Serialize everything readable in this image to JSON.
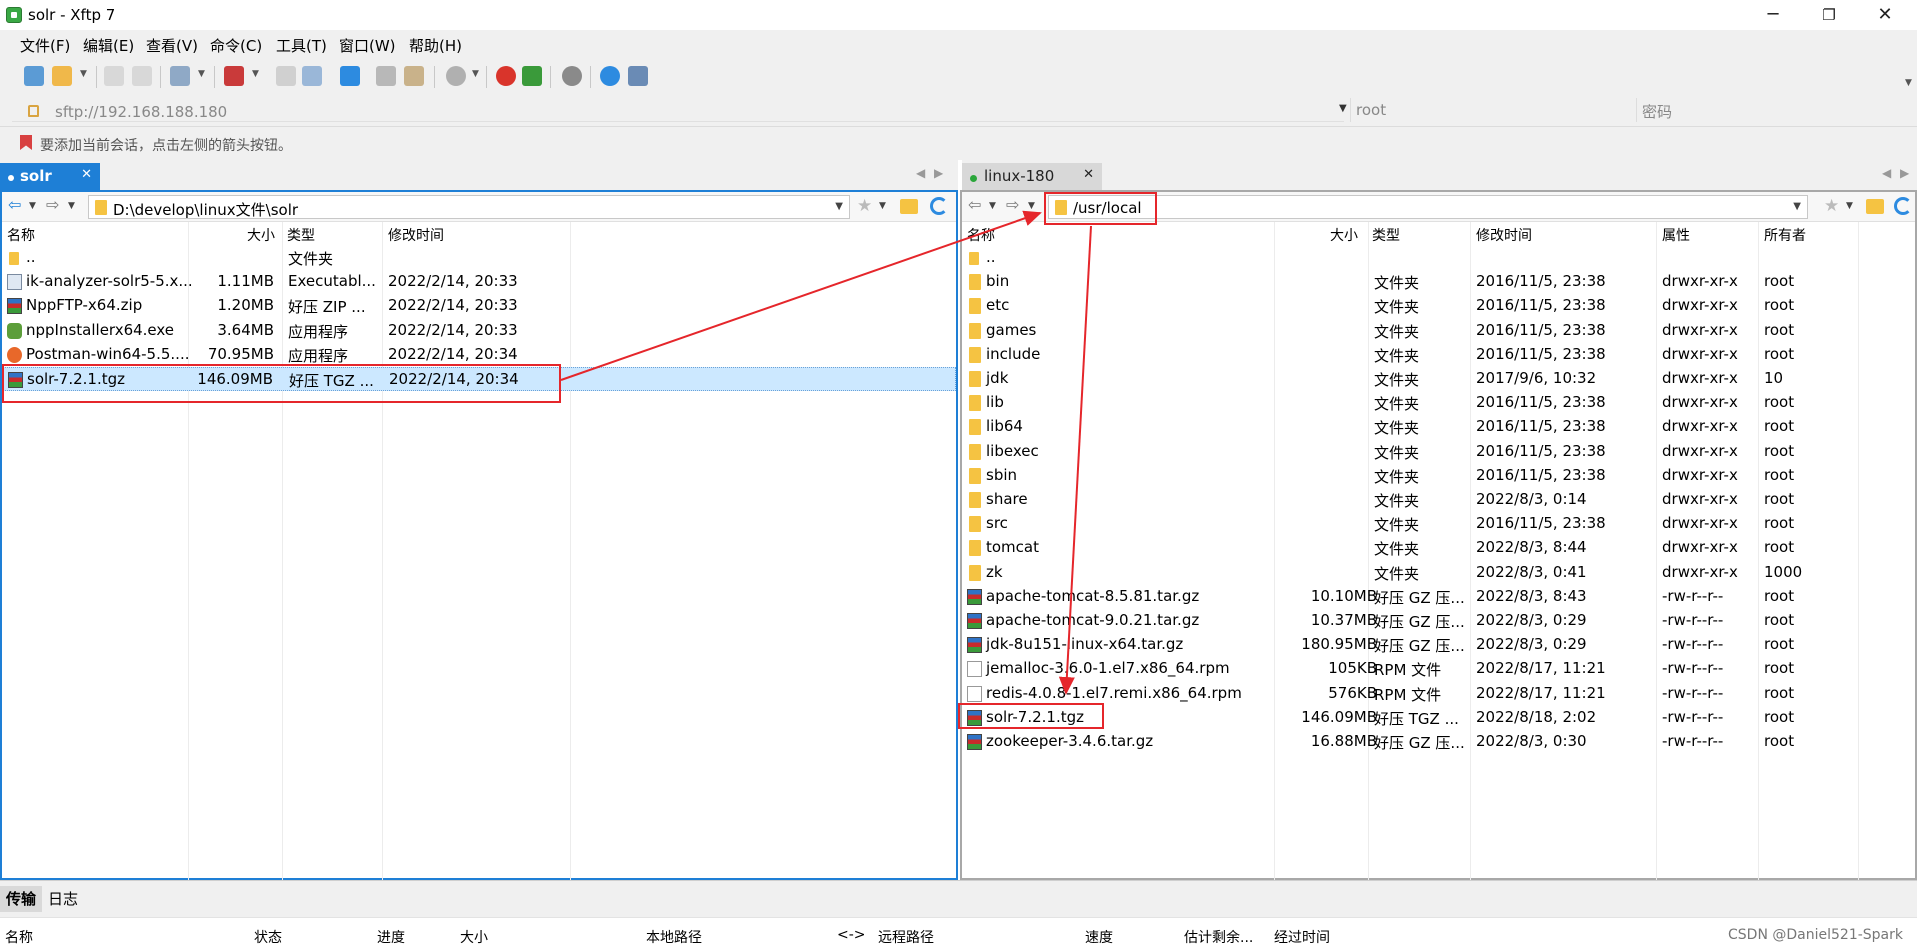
{
  "window": {
    "title": "solr - Xftp 7"
  },
  "menu": [
    "文件(F)",
    "编辑(E)",
    "查看(V)",
    "命令(C)",
    "工具(T)",
    "窗口(W)",
    "帮助(H)"
  ],
  "address": {
    "url": "sftp://192.168.188.180",
    "user_placeholder": "root",
    "password_placeholder": "密码"
  },
  "hint": "要添加当前会话，点击左侧的箭头按钮。",
  "local": {
    "tab": "solr",
    "path": "D:\\develop\\linux文件\\solr",
    "headers": {
      "name": "名称",
      "size": "大小",
      "type": "类型",
      "modified": "修改时间"
    },
    "files": [
      {
        "name": "..",
        "size": "",
        "type": "文件夹",
        "modified": "",
        "icon": "updir-icon"
      },
      {
        "name": "ik-analyzer-solr5-5.x...",
        "size": "1.11MB",
        "type": "Executabl...",
        "modified": "2022/2/14, 20:33",
        "icon": "executable-file-icon"
      },
      {
        "name": "NppFTP-x64.zip",
        "size": "1.20MB",
        "type": "好压 ZIP ...",
        "modified": "2022/2/14, 20:33",
        "icon": "archive-icon"
      },
      {
        "name": "nppInstallerx64.exe",
        "size": "3.64MB",
        "type": "应用程序",
        "modified": "2022/2/14, 20:33",
        "icon": "app-icon"
      },
      {
        "name": "Postman-win64-5.5....",
        "size": "70.95MB",
        "type": "应用程序",
        "modified": "2022/2/14, 20:34",
        "icon": "postman-icon"
      },
      {
        "name": "solr-7.2.1.tgz",
        "size": "146.09MB",
        "type": "好压 TGZ ...",
        "modified": "2022/2/14, 20:34",
        "icon": "archive-icon"
      }
    ]
  },
  "remote": {
    "tab": "linux-180",
    "path": "/usr/local",
    "headers": {
      "name": "名称",
      "size": "大小",
      "type": "类型",
      "modified": "修改时间",
      "perm": "属性",
      "owner": "所有者"
    },
    "files": [
      {
        "name": "..",
        "size": "",
        "type": "",
        "modified": "",
        "perm": "",
        "owner": "",
        "icon": "updir-icon"
      },
      {
        "name": "bin",
        "size": "",
        "type": "文件夹",
        "modified": "2016/11/5, 23:38",
        "perm": "drwxr-xr-x",
        "owner": "root",
        "icon": "folder-icon"
      },
      {
        "name": "etc",
        "size": "",
        "type": "文件夹",
        "modified": "2016/11/5, 23:38",
        "perm": "drwxr-xr-x",
        "owner": "root",
        "icon": "folder-icon"
      },
      {
        "name": "games",
        "size": "",
        "type": "文件夹",
        "modified": "2016/11/5, 23:38",
        "perm": "drwxr-xr-x",
        "owner": "root",
        "icon": "folder-icon"
      },
      {
        "name": "include",
        "size": "",
        "type": "文件夹",
        "modified": "2016/11/5, 23:38",
        "perm": "drwxr-xr-x",
        "owner": "root",
        "icon": "folder-icon"
      },
      {
        "name": "jdk",
        "size": "",
        "type": "文件夹",
        "modified": "2017/9/6, 10:32",
        "perm": "drwxr-xr-x",
        "owner": "10",
        "icon": "folder-icon"
      },
      {
        "name": "lib",
        "size": "",
        "type": "文件夹",
        "modified": "2016/11/5, 23:38",
        "perm": "drwxr-xr-x",
        "owner": "root",
        "icon": "folder-icon"
      },
      {
        "name": "lib64",
        "size": "",
        "type": "文件夹",
        "modified": "2016/11/5, 23:38",
        "perm": "drwxr-xr-x",
        "owner": "root",
        "icon": "folder-icon"
      },
      {
        "name": "libexec",
        "size": "",
        "type": "文件夹",
        "modified": "2016/11/5, 23:38",
        "perm": "drwxr-xr-x",
        "owner": "root",
        "icon": "folder-icon"
      },
      {
        "name": "sbin",
        "size": "",
        "type": "文件夹",
        "modified": "2016/11/5, 23:38",
        "perm": "drwxr-xr-x",
        "owner": "root",
        "icon": "folder-icon"
      },
      {
        "name": "share",
        "size": "",
        "type": "文件夹",
        "modified": "2022/8/3, 0:14",
        "perm": "drwxr-xr-x",
        "owner": "root",
        "icon": "folder-icon"
      },
      {
        "name": "src",
        "size": "",
        "type": "文件夹",
        "modified": "2016/11/5, 23:38",
        "perm": "drwxr-xr-x",
        "owner": "root",
        "icon": "folder-icon"
      },
      {
        "name": "tomcat",
        "size": "",
        "type": "文件夹",
        "modified": "2022/8/3, 8:44",
        "perm": "drwxr-xr-x",
        "owner": "root",
        "icon": "folder-icon"
      },
      {
        "name": "zk",
        "size": "",
        "type": "文件夹",
        "modified": "2022/8/3, 0:41",
        "perm": "drwxr-xr-x",
        "owner": "1000",
        "icon": "folder-icon"
      },
      {
        "name": "apache-tomcat-8.5.81.tar.gz",
        "size": "10.10MB",
        "type": "好压 GZ 压...",
        "modified": "2022/8/3, 8:43",
        "perm": "-rw-r--r--",
        "owner": "root",
        "icon": "archive-icon"
      },
      {
        "name": "apache-tomcat-9.0.21.tar.gz",
        "size": "10.37MB",
        "type": "好压 GZ 压...",
        "modified": "2022/8/3, 0:29",
        "perm": "-rw-r--r--",
        "owner": "root",
        "icon": "archive-icon"
      },
      {
        "name": "jdk-8u151-linux-x64.tar.gz",
        "size": "180.95MB",
        "type": "好压 GZ 压...",
        "modified": "2022/8/3, 0:29",
        "perm": "-rw-r--r--",
        "owner": "root",
        "icon": "archive-icon"
      },
      {
        "name": "jemalloc-3.6.0-1.el7.x86_64.rpm",
        "size": "105KB",
        "type": "RPM 文件",
        "modified": "2022/8/17, 11:21",
        "perm": "-rw-r--r--",
        "owner": "root",
        "icon": "file-icon"
      },
      {
        "name": "redis-4.0.8-1.el7.remi.x86_64.rpm",
        "size": "576KB",
        "type": "RPM 文件",
        "modified": "2022/8/17, 11:21",
        "perm": "-rw-r--r--",
        "owner": "root",
        "icon": "file-icon"
      },
      {
        "name": "solr-7.2.1.tgz",
        "size": "146.09MB",
        "type": "好压 TGZ ...",
        "modified": "2022/8/18, 2:02",
        "perm": "-rw-r--r--",
        "owner": "root",
        "icon": "archive-icon"
      },
      {
        "name": "zookeeper-3.4.6.tar.gz",
        "size": "16.88MB",
        "type": "好压 GZ 压...",
        "modified": "2022/8/3, 0:30",
        "perm": "-rw-r--r--",
        "owner": "root",
        "icon": "archive-icon"
      }
    ]
  },
  "transfer": {
    "tabs": [
      "传输",
      "日志"
    ],
    "headers": [
      "名称",
      "状态",
      "进度",
      "大小",
      "本地路径",
      "<->",
      "远程路径",
      "速度",
      "估计剩余...",
      "经过时间"
    ]
  },
  "watermark": "CSDN @Daniel521-Spark",
  "colors": {
    "accent": "#1e7fd6",
    "highlight": "#e5262b",
    "selection": "#cce8ff"
  }
}
